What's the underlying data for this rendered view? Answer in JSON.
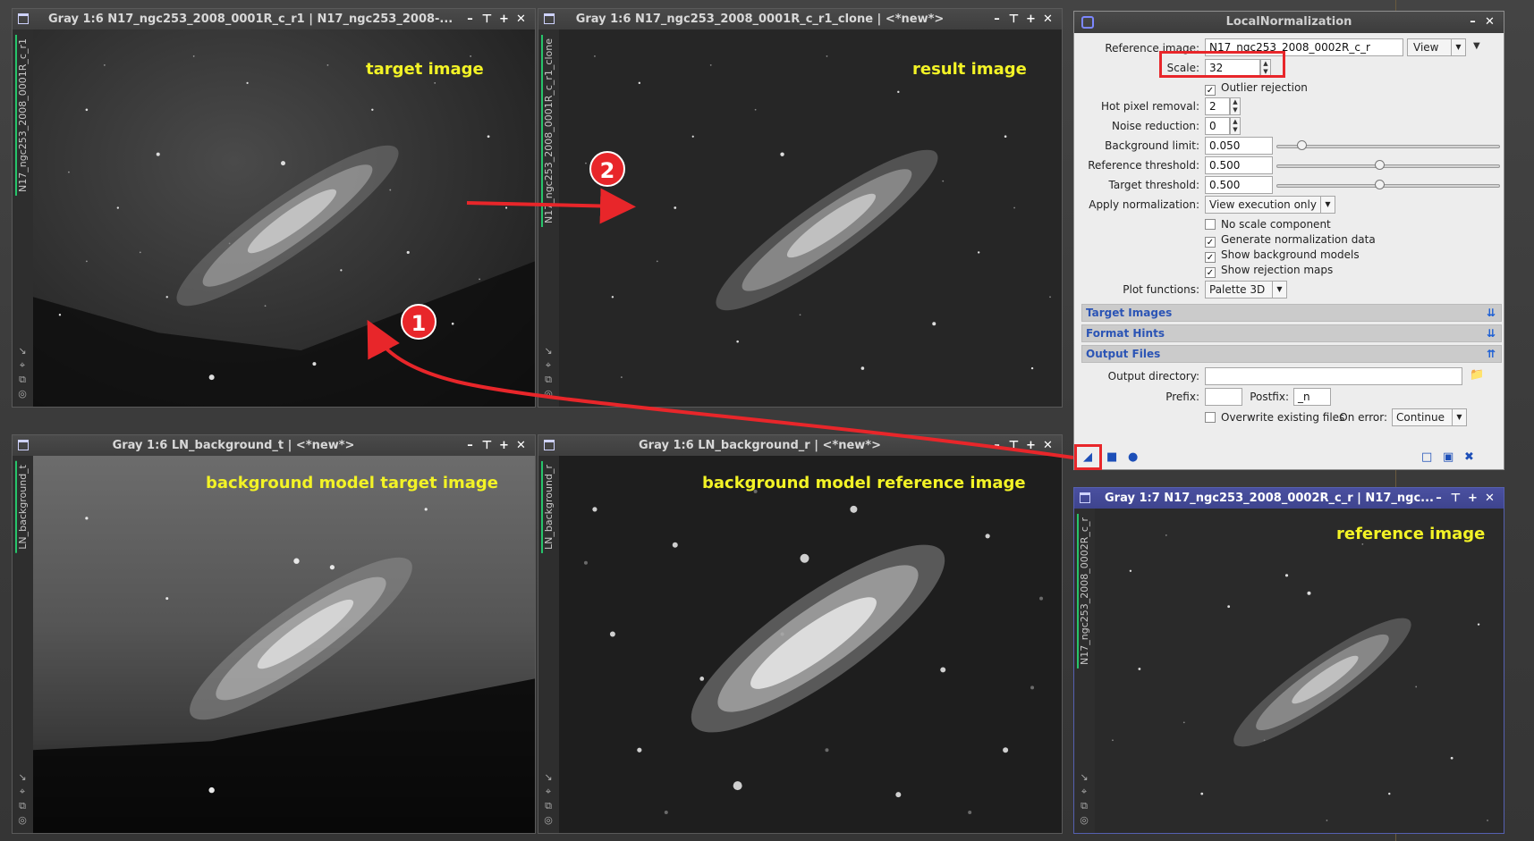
{
  "windows": [
    {
      "key": "target",
      "title": "Gray 1:6 N17_ngc253_2008_0001R_c_r1 | N17_ngc253_2008-...",
      "side_label": "N17_ngc253_2008_0001R_c_r1",
      "overlay": "target image"
    },
    {
      "key": "result",
      "title": "Gray 1:6 N17_ngc253_2008_0001R_c_r1_clone | <*new*>",
      "side_label": "N17_ngc253_2008_0001R_c_r1_clone",
      "overlay": "result image"
    },
    {
      "key": "bg_t",
      "title": "Gray 1:6 LN_background_t | <*new*>",
      "side_label": "LN_background_t",
      "overlay": "background model target image"
    },
    {
      "key": "bg_r",
      "title": "Gray 1:6 LN_background_r | <*new*>",
      "side_label": "LN_background_r",
      "overlay": "background model reference image"
    },
    {
      "key": "ref",
      "title": "Gray 1:7 N17_ngc253_2008_0002R_c_r | N17_ngc...",
      "side_label": "N17_ngc253_2008_0002R_c_r",
      "overlay": "reference image"
    }
  ],
  "panel": {
    "title": "LocalNormalization",
    "reference_image_label": "Reference image:",
    "reference_image_value": "N17_ngc253_2008_0002R_c_r",
    "view_button": "View",
    "scale_label": "Scale:",
    "scale_value": "32",
    "outlier_rejection": "Outlier rejection",
    "hot_pixel_label": "Hot pixel removal:",
    "hot_pixel_value": "2",
    "noise_label": "Noise reduction:",
    "noise_value": "0",
    "bg_limit_label": "Background limit:",
    "bg_limit_value": "0.050",
    "ref_threshold_label": "Reference threshold:",
    "ref_threshold_value": "0.500",
    "target_threshold_label": "Target threshold:",
    "target_threshold_value": "0.500",
    "apply_label": "Apply normalization:",
    "apply_value": "View execution only",
    "no_scale": "No scale component",
    "gen_norm": "Generate normalization data",
    "show_bg": "Show background models",
    "show_rej": "Show rejection maps",
    "plot_label": "Plot functions:",
    "plot_value": "Palette 3D",
    "section_target": "Target Images",
    "section_format": "Format Hints",
    "section_output": "Output Files",
    "output_dir_label": "Output directory:",
    "output_dir_value": "",
    "prefix_label": "Prefix:",
    "prefix_value": "",
    "postfix_label": "Postfix:",
    "postfix_value": "_n",
    "overwrite": "Overwrite existing files",
    "on_error_label": "On error:",
    "on_error_value": "Continue"
  },
  "callouts": {
    "one": "1",
    "two": "2"
  },
  "colors": {
    "annotation": "#e8262a",
    "label_yellow": "#f3f326",
    "section_blue": "#2b54b5"
  }
}
